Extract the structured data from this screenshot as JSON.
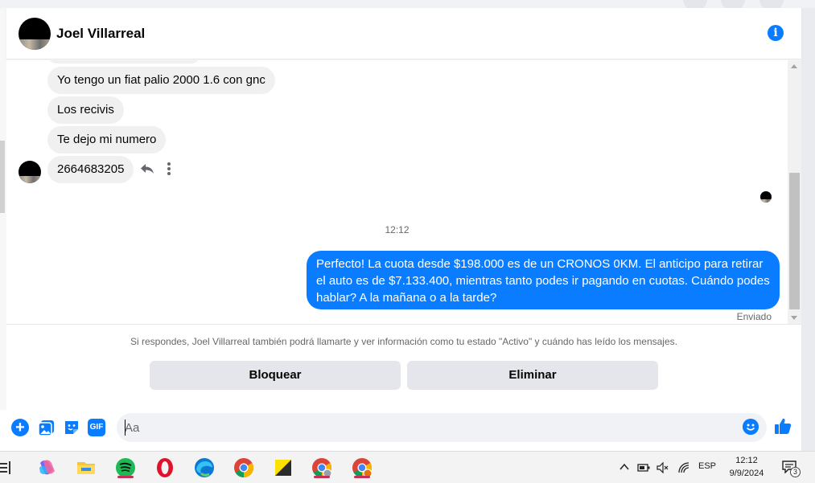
{
  "header": {
    "contact_name": "Joel Villarreal",
    "info_icon": "info-icon"
  },
  "messages": {
    "incoming": [
      "Yo tengo un fiat palio 2000 1.6 con gnc",
      "Los recivis",
      "Te  dejo mi numero",
      "2664683205"
    ],
    "timestamp": "12:12",
    "outgoing": "Perfecto! La cuota desde $198.000 es de un CRONOS 0KM. El anticipo para retirar el auto es de $7.133.400, mientras tanto podes ir pagando en cuotas. Cuándo podes hablar? A la mañana o a la tarde?",
    "outgoing_status": "Enviado"
  },
  "notice": {
    "text": "Si respondes, Joel Villarreal también podrá llamarte y ver información como tu estado \"Activo\" y cuándo has leído los mensajes.",
    "block_label": "Bloquear",
    "delete_label": "Eliminar"
  },
  "composer": {
    "placeholder": "Aa",
    "gif_label": "GIF"
  },
  "taskbar": {
    "language": "ESP",
    "time": "12:12",
    "date": "9/9/2024",
    "notification_count": "3"
  },
  "colors": {
    "accent": "#0a7cff",
    "incoming_bubble": "#f0f0f0",
    "button_gray": "#e4e6eb"
  }
}
